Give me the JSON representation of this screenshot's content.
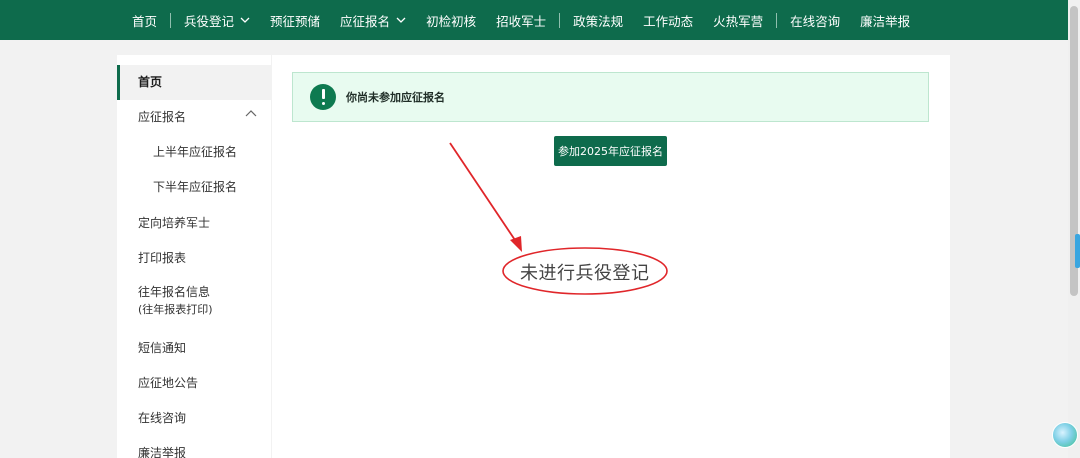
{
  "nav": {
    "items": [
      {
        "label": "首页"
      },
      {
        "label": "兵役登记"
      },
      {
        "label": "预征预储"
      },
      {
        "label": "应征报名"
      },
      {
        "label": "初检初核"
      },
      {
        "label": "招收军士"
      },
      {
        "label": "政策法规"
      },
      {
        "label": "工作动态"
      },
      {
        "label": "火热军营"
      },
      {
        "label": "在线咨询"
      },
      {
        "label": "廉洁举报"
      }
    ]
  },
  "sidebar": {
    "items": [
      {
        "label": "首页"
      },
      {
        "label": "应征报名"
      },
      {
        "label": "上半年应征报名"
      },
      {
        "label": "下半年应征报名"
      },
      {
        "label": "定向培养军士"
      },
      {
        "label": "打印报表"
      },
      {
        "label": "往年报名信息",
        "note": "(往年报表打印)"
      },
      {
        "label": "短信通知"
      },
      {
        "label": "应征地公告"
      },
      {
        "label": "在线咨询"
      },
      {
        "label": "廉洁举报"
      }
    ]
  },
  "alert": {
    "text": "你尚未参加应征报名"
  },
  "actions": {
    "join_label": "参加2025年应征报名"
  },
  "annotation": {
    "text": "未进行兵役登记",
    "color": "#e0262a"
  },
  "colors": {
    "brand": "#0e6b4c",
    "alert_bg": "#e8fbf0"
  }
}
